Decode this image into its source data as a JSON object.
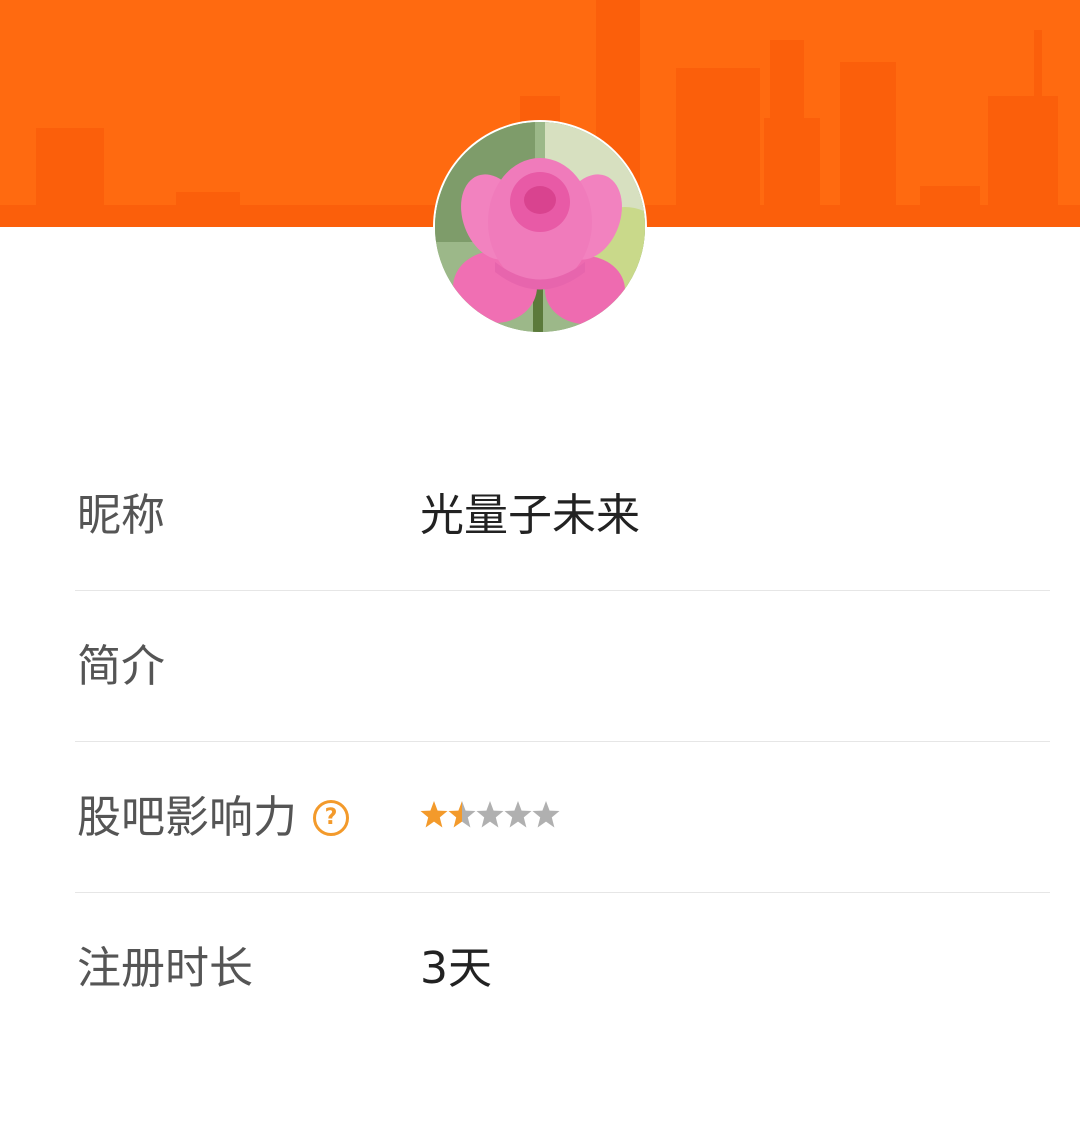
{
  "profile": {
    "avatar_icon": "lotus-flower-photo",
    "fields": {
      "nickname_label": "昵称",
      "nickname_value": "光量子未来",
      "bio_label": "简介",
      "bio_value": "",
      "influence_label": "股吧影响力",
      "influence_help_icon": "question-circle-icon",
      "influence_help_glyph": "?",
      "influence_rating": 1.5,
      "influence_rating_max": 5,
      "register_label": "注册时长",
      "register_value": "3天"
    }
  },
  "colors": {
    "banner": "#ff6a10",
    "accent": "#f39a2b",
    "star_empty": "#b0b0b0"
  }
}
